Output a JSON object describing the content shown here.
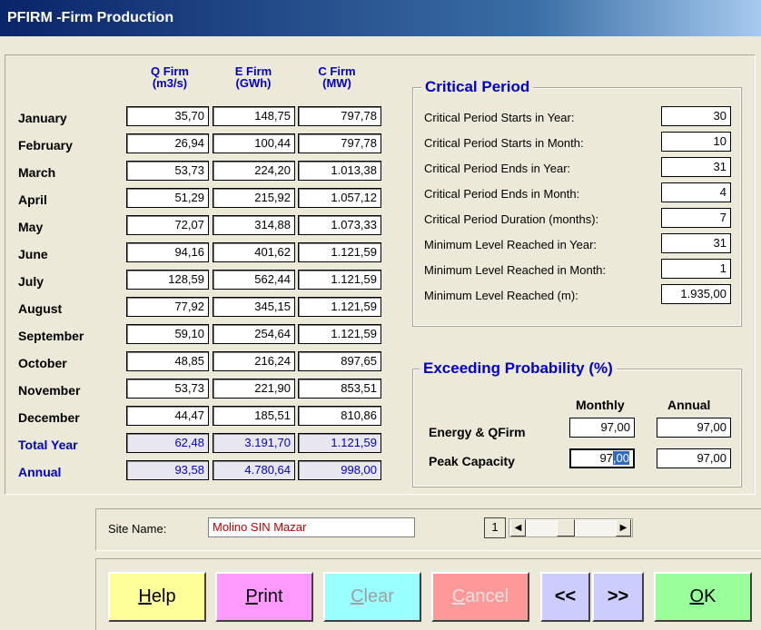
{
  "window": {
    "title": "PFIRM -Firm Production"
  },
  "columns": [
    {
      "line1": "Q Firm",
      "line2": "(m3/s)"
    },
    {
      "line1": "E Firm",
      "line2": "(GWh)"
    },
    {
      "line1": "C Firm",
      "line2": "(MW)"
    }
  ],
  "rows": [
    {
      "label": "January",
      "q": "35,70",
      "e": "148,75",
      "c": "797,78"
    },
    {
      "label": "February",
      "q": "26,94",
      "e": "100,44",
      "c": "797,78"
    },
    {
      "label": "March",
      "q": "53,73",
      "e": "224,20",
      "c": "1.013,38"
    },
    {
      "label": "April",
      "q": "51,29",
      "e": "215,92",
      "c": "1.057,12"
    },
    {
      "label": "May",
      "q": "72,07",
      "e": "314,88",
      "c": "1.073,33"
    },
    {
      "label": "June",
      "q": "94,16",
      "e": "401,62",
      "c": "1.121,59"
    },
    {
      "label": "July",
      "q": "128,59",
      "e": "562,44",
      "c": "1.121,59"
    },
    {
      "label": "August",
      "q": "77,92",
      "e": "345,15",
      "c": "1.121,59"
    },
    {
      "label": "September",
      "q": "59,10",
      "e": "254,64",
      "c": "1.121,59"
    },
    {
      "label": "October",
      "q": "48,85",
      "e": "216,24",
      "c": "897,65"
    },
    {
      "label": "November",
      "q": "53,73",
      "e": "221,90",
      "c": "853,51"
    },
    {
      "label": "December",
      "q": "44,47",
      "e": "185,51",
      "c": "810,86"
    },
    {
      "label": "Total Year",
      "q": "62,48",
      "e": "3.191,70",
      "c": "1.121,59"
    },
    {
      "label": "Annual",
      "q": "93,58",
      "e": "4.780,64",
      "c": "998,00"
    }
  ],
  "critical": {
    "title": "Critical Period",
    "items": [
      {
        "label": "Critical Period Starts in Year:",
        "value": "30"
      },
      {
        "label": "Critical Period Starts in Month:",
        "value": "10"
      },
      {
        "label": "Critical Period Ends in Year:",
        "value": "31"
      },
      {
        "label": "Critical Period Ends in Month:",
        "value": "4"
      },
      {
        "label": "Critical Period Duration (months):",
        "value": "7"
      },
      {
        "label": "Minimum Level Reached in Year:",
        "value": "31"
      },
      {
        "label": "Minimum Level Reached in Month:",
        "value": "1"
      },
      {
        "label": "Minimum Level Reached (m):",
        "value": "1.935,00"
      }
    ]
  },
  "exceeding": {
    "title": "Exceeding Probability (%)",
    "col_monthly": "Monthly",
    "col_annual": "Annual",
    "energy_label": "Energy & QFirm",
    "energy_monthly": "97,00",
    "energy_annual": "97,00",
    "peak_label": "Peak Capacity",
    "peak_monthly_plain": "97",
    "peak_monthly_selected": ",00",
    "peak_annual": "97,00"
  },
  "site": {
    "label": "Site Name:",
    "value": "Molino SIN Mazar",
    "record": "1",
    "left_arrow": "◀",
    "right_arrow": "▶"
  },
  "buttons": {
    "help_u": "H",
    "help_rest": "elp",
    "print_u": "P",
    "print_rest": "rint",
    "clear_u": "C",
    "clear_rest": "lear",
    "cancel_u": "C",
    "cancel_rest": "ancel",
    "prev": "<<",
    "next": ">>",
    "ok_u": "O",
    "ok_rest": "K"
  },
  "colors": {
    "help": "#ffff99",
    "print": "#ff99ff",
    "clear": "#99ffff",
    "cancel": "#ff9999",
    "nav": "#ccccff",
    "ok": "#99ff99",
    "accent": "#0000cc"
  }
}
